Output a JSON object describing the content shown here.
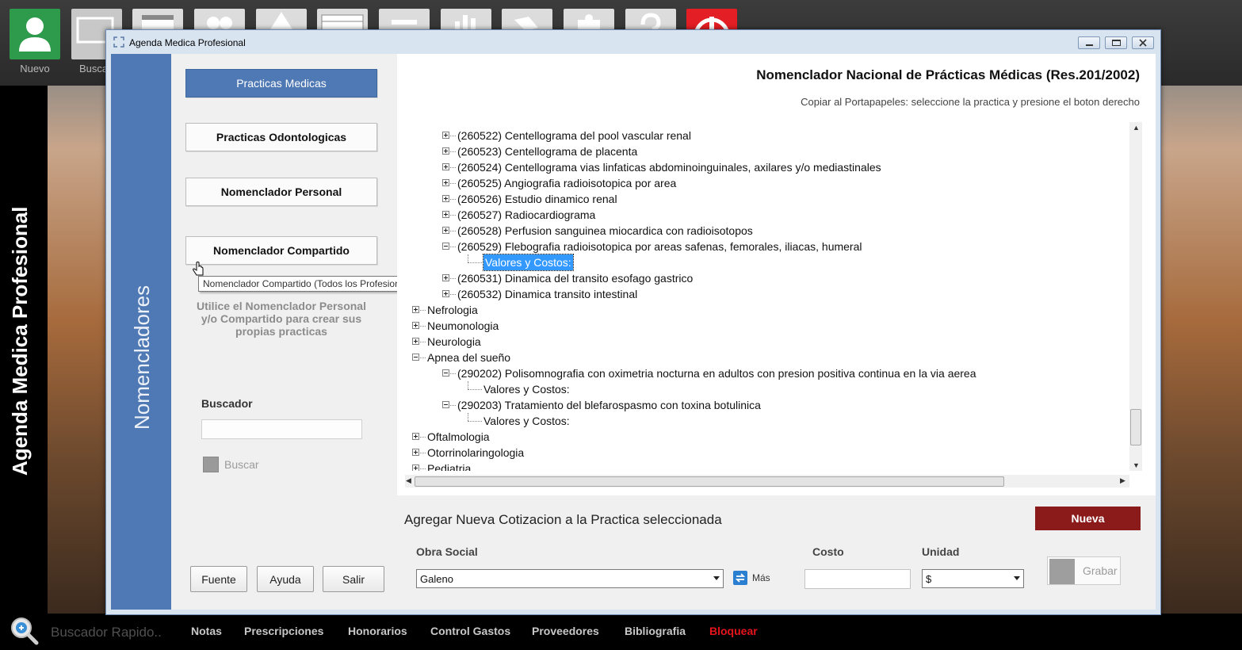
{
  "toolbar": {
    "items": [
      {
        "label": "Nuevo",
        "icon": "user-icon"
      },
      {
        "label": "Buscar",
        "icon": "monitor-search-icon"
      },
      {
        "label": "",
        "icon": "calendar-icon"
      },
      {
        "label": "",
        "icon": "users-icon"
      },
      {
        "label": "",
        "icon": "triangle-icon"
      },
      {
        "label": "",
        "icon": "table-icon"
      },
      {
        "label": "",
        "icon": "minus-icon"
      },
      {
        "label": "",
        "icon": "bar-chart-icon"
      },
      {
        "label": "",
        "icon": "tag-icon"
      },
      {
        "label": "",
        "icon": "puzzle-icon"
      },
      {
        "label": "",
        "icon": "help-icon"
      },
      {
        "label": "",
        "icon": "power-icon"
      }
    ],
    "nuevo_label": "Nuevo",
    "buscar_label": "Buscar"
  },
  "app": {
    "vertical_title": "Agenda Medica Profesional"
  },
  "window": {
    "title": "Agenda Medica Profesional",
    "strip_title": "Nomencladores"
  },
  "nav": {
    "practicas_medicas": "Practicas Medicas",
    "practicas_odontologicas": "Practicas Odontologicas",
    "nomenclador_personal": "Nomenclador Personal",
    "nomenclador_compartido": "Nomenclador Compartido",
    "tooltip": "Nomenclador Compartido (Todos los Profesionales)",
    "help_text_1": "Utilice el Nomenclador Personal",
    "help_text_2": "y/o Compartido para crear sus",
    "help_text_3": "propias practicas"
  },
  "search": {
    "label": "Buscador",
    "value": "",
    "button": "Buscar"
  },
  "bottom_buttons": {
    "fuente": "Fuente",
    "ayuda": "Ayuda",
    "salir": "Salir"
  },
  "content": {
    "title": "Nomenclador Nacional de Prácticas Médicas (Res.201/2002)",
    "hint": "Copiar al Portapapeles: seleccione la practica y presione el boton derecho"
  },
  "tree": [
    {
      "text": "(260522) Centellograma del pool vascular renal",
      "level": 1,
      "expander": "plus"
    },
    {
      "text": "(260523) Centellograma de placenta",
      "level": 1,
      "expander": "plus"
    },
    {
      "text": "(260524) Centellograma vias linfaticas abdominoinguinales, axilares y/o mediastinales",
      "level": 1,
      "expander": "plus"
    },
    {
      "text": "(260525) Angiografia radioisotopica por area",
      "level": 1,
      "expander": "plus"
    },
    {
      "text": "(260526) Estudio dinamico renal",
      "level": 1,
      "expander": "plus"
    },
    {
      "text": "(260527) Radiocardiograma",
      "level": 1,
      "expander": "plus"
    },
    {
      "text": "(260528) Perfusion sanguinea miocardica con radioisotopos",
      "level": 1,
      "expander": "plus"
    },
    {
      "text": "(260529) Flebografia radioisotopica por areas safenas, femorales, iliacas, humeral",
      "level": 1,
      "expander": "minus"
    },
    {
      "text": "Valores y Costos:",
      "level": 2,
      "expander": "none",
      "selected": true
    },
    {
      "text": "(260531) Dinamica del transito esofago gastrico",
      "level": 1,
      "expander": "plus"
    },
    {
      "text": "(260532) Dinamica transito intestinal",
      "level": 1,
      "expander": "plus"
    },
    {
      "text": "Nefrologia",
      "level": 0,
      "expander": "plus"
    },
    {
      "text": "Neumonologia",
      "level": 0,
      "expander": "plus"
    },
    {
      "text": "Neurologia",
      "level": 0,
      "expander": "plus"
    },
    {
      "text": "Apnea del sueño",
      "level": 0,
      "expander": "minus"
    },
    {
      "text": "(290202) Polisomnografia con oximetria nocturna en adultos con presion positiva continua en la via aerea",
      "level": 1,
      "expander": "minus"
    },
    {
      "text": "Valores y Costos:",
      "level": 2,
      "expander": "none"
    },
    {
      "text": "(290203) Tratamiento del blefarospasmo con toxina botulinica",
      "level": 1,
      "expander": "minus"
    },
    {
      "text": "Valores y Costos:",
      "level": 2,
      "expander": "none"
    },
    {
      "text": "Oftalmologia",
      "level": 0,
      "expander": "plus"
    },
    {
      "text": "Otorrinolaringologia",
      "level": 0,
      "expander": "plus"
    },
    {
      "text": "Pediatria",
      "level": 0,
      "expander": "plus"
    }
  ],
  "cotizacion": {
    "title": "Agregar Nueva Cotizacion a la Practica seleccionada",
    "nueva_button": "Nueva",
    "obra_social_label": "Obra Social",
    "obra_social_value": "Galeno",
    "mas_label": "Más",
    "costo_label": "Costo",
    "costo_value": "",
    "unidad_label": "Unidad",
    "unidad_value": "$",
    "grabar_button": "Grabar"
  },
  "bottom_bar": {
    "quick_search_placeholder": "Buscador Rapido..",
    "menu": [
      {
        "label": "Notas",
        "color": "#c8c8c8"
      },
      {
        "label": "Prescripciones",
        "color": "#c8c8c8"
      },
      {
        "label": "Honorarios",
        "color": "#c8c8c8"
      },
      {
        "label": "Control Gastos",
        "color": "#c8c8c8"
      },
      {
        "label": "Proveedores",
        "color": "#c8c8c8"
      },
      {
        "label": "Bibliografia",
        "color": "#c8c8c8"
      },
      {
        "label": "Bloquear",
        "color": "#e8141c"
      }
    ]
  },
  "colors": {
    "accent_blue": "#4f79b4",
    "nueva_red": "#8b1a1a",
    "selection": "#3399ff"
  }
}
